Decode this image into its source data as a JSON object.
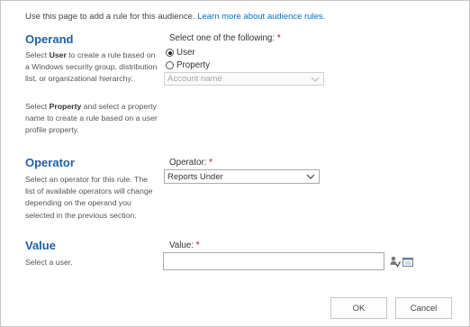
{
  "intro": {
    "text": "Use this page to add a rule for this audience.",
    "link": "Learn more about audience rules."
  },
  "operand": {
    "title": "Operand",
    "desc_part1": "Select ",
    "desc_bold1": "User",
    "desc_part2": " to create a rule based on a Windows security group, distribution list, or organizational hierarchy.",
    "desc2_part1": "Select ",
    "desc2_bold": "Property",
    "desc2_part2": " and select a property name to create a rule based on a user profile property.",
    "field_label": "Select one of the following:",
    "required": "*",
    "options": [
      {
        "label": "User",
        "checked": true
      },
      {
        "label": "Property",
        "checked": false
      }
    ],
    "property_select_value": "Account name"
  },
  "operator": {
    "title": "Operator",
    "desc": "Select an operator for this rule. The list of available operators will change depending on the operand you selected in the previous section.",
    "field_label": "Operator:",
    "required": "*",
    "selected": "Reports Under"
  },
  "value": {
    "title": "Value",
    "desc": "Select a user.",
    "field_label": "Value:",
    "required": "*",
    "input_value": "",
    "check_names_icon": "check-names-icon",
    "browse_icon": "address-book-icon"
  },
  "buttons": {
    "ok": "OK",
    "cancel": "Cancel"
  }
}
